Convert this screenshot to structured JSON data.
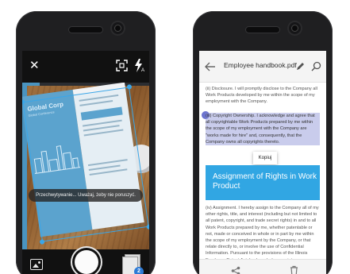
{
  "scanner": {
    "toast_text": "Przechwytywanie... Uważaj, żeby nie poruszyć.",
    "brochure_title": "Global Corp",
    "brochure_subtitle": "Global Conference",
    "page_count": "2",
    "icons": {
      "close": "close-icon",
      "crop": "crop-icon",
      "flash": "flash-auto-icon",
      "gallery": "gallery-icon",
      "shutter": "shutter-button",
      "thumbnails": "scanned-pages-thumbnail"
    },
    "colors": {
      "scan_outline": "#3aa6e8",
      "badge": "#2e7bd6"
    }
  },
  "viewer": {
    "title": "Employee handbook.pdf",
    "paragraph_1": "(ii) Disclosure. I will promptly disclose to the Company all Work Products developed by me within the scope of my employment with the Company.",
    "paragraph_2": "(iii) Copyright Ownership. I acknowledge and agree that all copyrightable Work Products prepared by me within the scope of my employment with the Company are \"works made for hire\" and, consequently, that the Company owns all copyrights thereto.",
    "copy_label": "Kopiuj",
    "banner_title": "Assignment of Rights in Work Product",
    "paragraph_3": "(iv) Assignment. I hereby assign to the Company all of my other rights, title, and interest (including but not limited to all patent, copyright, and trade secret rights) in and to all Work Products prepared by me, whether patentable or not, made or conceived in whole or in part by me within the scope of my employment by the Company, or that relate directly to, or involve the use of Confidential Information. Pursuant to the provisions of the Illinois Employee Patent Act, I acknowledge receipt",
    "icons": {
      "back": "back-arrow-icon",
      "edit": "pencil-icon",
      "search": "search-icon",
      "share": "share-icon",
      "delete": "trash-icon"
    },
    "colors": {
      "banner": "#31a6e3",
      "selection": "#888ed4"
    }
  }
}
